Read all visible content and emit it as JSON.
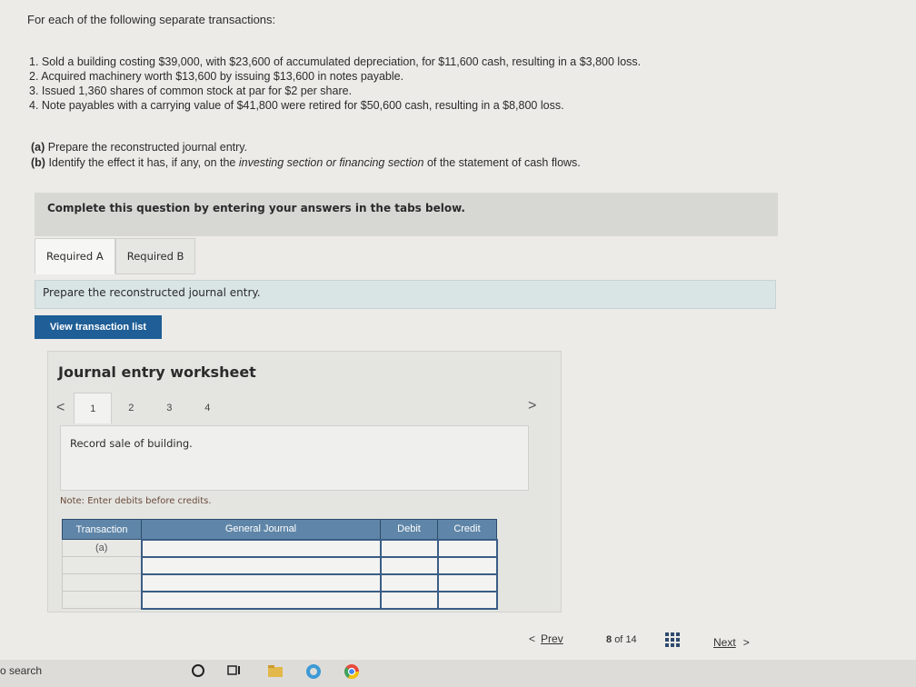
{
  "intro": "For each of the following separate transactions:",
  "transactions": [
    "1. Sold a building costing $39,000, with $23,600 of accumulated depreciation, for $11,600 cash, resulting in a $3,800 loss.",
    "2. Acquired machinery worth $13,600 by issuing $13,600 in notes payable.",
    "3. Issued 1,360 shares of common stock at par for $2 per share.",
    "4. Note payables with a carrying value of $41,800 were retired for $50,600 cash, resulting in a $8,800 loss."
  ],
  "parts": {
    "a_label": "(a)",
    "a_text": "Prepare the reconstructed journal entry.",
    "b_label": "(b)",
    "b_text1": "Identify the effect it has, if any, on the",
    "b_text_italic": "investing section or financing section",
    "b_text2": "of the statement of cash flows."
  },
  "banner": "Complete this question by entering your answers in the tabs below.",
  "tabs": [
    "Required A",
    "Required B"
  ],
  "instruction": "Prepare the reconstructed journal entry.",
  "view_button": "View transaction list",
  "worksheet": {
    "title": "Journal entry worksheet",
    "prev_arrow": "<",
    "next_arrow": ">",
    "pages": [
      "1",
      "2",
      "3",
      "4"
    ],
    "description": "Record sale of building.",
    "note": "Note: Enter debits before credits."
  },
  "table": {
    "headers": [
      "Transaction",
      "General Journal",
      "Debit",
      "Credit"
    ],
    "first_transaction": "(a)"
  },
  "nav": {
    "prev_arrow": "<",
    "prev": "Prev",
    "current": "8",
    "of": "of",
    "total": "14",
    "next": "Next",
    "next_arrow": ">"
  },
  "taskbar": {
    "search": "o search"
  }
}
